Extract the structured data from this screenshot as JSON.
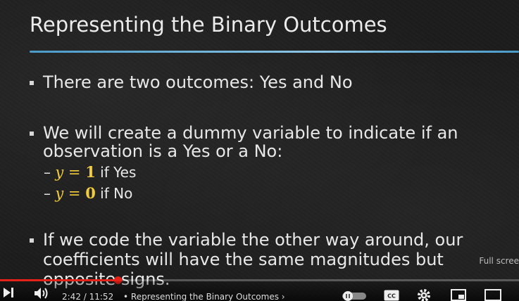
{
  "slide": {
    "title": "Representing the Binary Outcomes",
    "bullets": [
      {
        "lines": [
          "There are two outcomes: Yes and No"
        ]
      },
      {
        "lines": [
          "We will create a dummy variable to indicate if an",
          "observation is a Yes or a No:"
        ],
        "subitems": [
          {
            "dash": "–",
            "var": "y",
            "eq": " = ",
            "val": "1",
            "cond": " if  Yes"
          },
          {
            "dash": "–",
            "var": "y",
            "eq": " = ",
            "val": "0",
            "cond": " if No"
          }
        ]
      },
      {
        "lines": [
          "If we code the variable the other way around, our",
          "coefficients will have the same magnitudes but",
          "opposite signs."
        ]
      }
    ]
  },
  "player": {
    "time_display": "2:42 / 11:52",
    "chapter": "• Representing the Binary Outcomes",
    "chapter_chevron": "›",
    "fullscreen_hint": "Full scree",
    "progress_fraction": 0.227,
    "accent_color": "#e62117",
    "cc_label": "CC",
    "icons": [
      "next-icon",
      "volume-icon",
      "autoplay-toggle-icon",
      "captions-icon",
      "settings-icon",
      "miniplayer-icon",
      "theater-mode-icon"
    ]
  }
}
